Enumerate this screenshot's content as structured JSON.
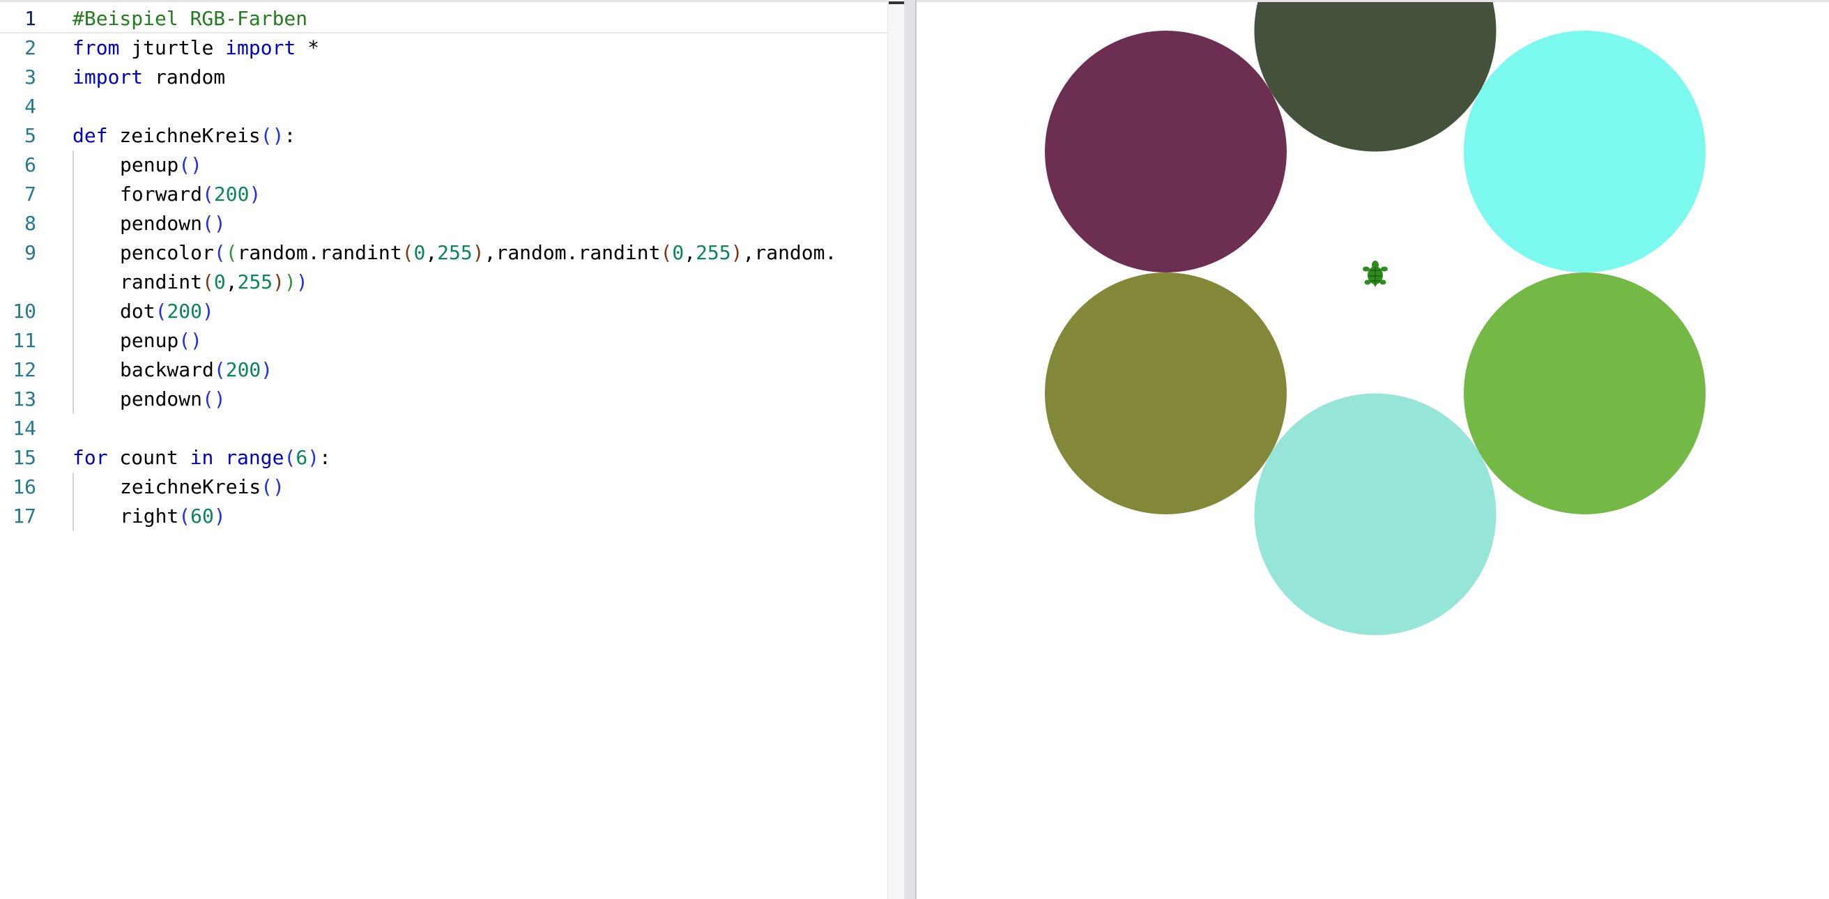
{
  "editor": {
    "lines": [
      {
        "num": "1",
        "indent": 0,
        "tokens": [
          {
            "t": "#Beispiel RGB-Farben",
            "c": "comment"
          }
        ]
      },
      {
        "num": "2",
        "indent": 0,
        "tokens": [
          {
            "t": "from",
            "c": "keyword"
          },
          {
            "t": " jturtle ",
            "c": "ident"
          },
          {
            "t": "import",
            "c": "keyword"
          },
          {
            "t": " *",
            "c": "op"
          }
        ]
      },
      {
        "num": "3",
        "indent": 0,
        "tokens": [
          {
            "t": "import",
            "c": "keyword"
          },
          {
            "t": " random",
            "c": "ident"
          }
        ]
      },
      {
        "num": "4",
        "indent": 0,
        "tokens": []
      },
      {
        "num": "5",
        "indent": 0,
        "tokens": [
          {
            "t": "def",
            "c": "keyword"
          },
          {
            "t": " zeichneKreis",
            "c": "ident"
          },
          {
            "t": "()",
            "c": "bracket1"
          },
          {
            "t": ":",
            "c": "op"
          }
        ]
      },
      {
        "num": "6",
        "indent": 1,
        "tokens": [
          {
            "t": "penup",
            "c": "ident"
          },
          {
            "t": "()",
            "c": "bracket1"
          }
        ]
      },
      {
        "num": "7",
        "indent": 1,
        "tokens": [
          {
            "t": "forward",
            "c": "ident"
          },
          {
            "t": "(",
            "c": "bracket1"
          },
          {
            "t": "200",
            "c": "number"
          },
          {
            "t": ")",
            "c": "bracket1"
          }
        ]
      },
      {
        "num": "8",
        "indent": 1,
        "tokens": [
          {
            "t": "pendown",
            "c": "ident"
          },
          {
            "t": "()",
            "c": "bracket1"
          }
        ]
      },
      {
        "num": "9",
        "indent": 1,
        "tokens": [
          {
            "t": "pencolor",
            "c": "ident"
          },
          {
            "t": "(",
            "c": "bracket1"
          },
          {
            "t": "(",
            "c": "bracket2"
          },
          {
            "t": "random.randint",
            "c": "ident"
          },
          {
            "t": "(",
            "c": "bracket3"
          },
          {
            "t": "0",
            "c": "number"
          },
          {
            "t": ",",
            "c": "op"
          },
          {
            "t": "255",
            "c": "number"
          },
          {
            "t": ")",
            "c": "bracket3"
          },
          {
            "t": ",random.randint",
            "c": "ident"
          },
          {
            "t": "(",
            "c": "bracket3"
          },
          {
            "t": "0",
            "c": "number"
          },
          {
            "t": ",",
            "c": "op"
          },
          {
            "t": "255",
            "c": "number"
          },
          {
            "t": ")",
            "c": "bracket3"
          },
          {
            "t": ",random.",
            "c": "ident"
          }
        ]
      },
      {
        "num": "",
        "indent": 1,
        "tokens": [
          {
            "t": "randint",
            "c": "ident"
          },
          {
            "t": "(",
            "c": "bracket3"
          },
          {
            "t": "0",
            "c": "number"
          },
          {
            "t": ",",
            "c": "op"
          },
          {
            "t": "255",
            "c": "number"
          },
          {
            "t": ")",
            "c": "bracket3"
          },
          {
            "t": ")",
            "c": "bracket2"
          },
          {
            "t": ")",
            "c": "bracket1"
          }
        ]
      },
      {
        "num": "10",
        "indent": 1,
        "tokens": [
          {
            "t": "dot",
            "c": "ident"
          },
          {
            "t": "(",
            "c": "bracket1"
          },
          {
            "t": "200",
            "c": "number"
          },
          {
            "t": ")",
            "c": "bracket1"
          }
        ]
      },
      {
        "num": "11",
        "indent": 1,
        "tokens": [
          {
            "t": "penup",
            "c": "ident"
          },
          {
            "t": "()",
            "c": "bracket1"
          }
        ]
      },
      {
        "num": "12",
        "indent": 1,
        "tokens": [
          {
            "t": "backward",
            "c": "ident"
          },
          {
            "t": "(",
            "c": "bracket1"
          },
          {
            "t": "200",
            "c": "number"
          },
          {
            "t": ")",
            "c": "bracket1"
          }
        ]
      },
      {
        "num": "13",
        "indent": 1,
        "tokens": [
          {
            "t": "pendown",
            "c": "ident"
          },
          {
            "t": "()",
            "c": "bracket1"
          }
        ]
      },
      {
        "num": "14",
        "indent": 0,
        "tokens": []
      },
      {
        "num": "15",
        "indent": 0,
        "tokens": [
          {
            "t": "for",
            "c": "keyword"
          },
          {
            "t": " count ",
            "c": "ident"
          },
          {
            "t": "in",
            "c": "keyword"
          },
          {
            "t": " ",
            "c": "ident"
          },
          {
            "t": "range",
            "c": "builtin"
          },
          {
            "t": "(",
            "c": "bracket1"
          },
          {
            "t": "6",
            "c": "number"
          },
          {
            "t": ")",
            "c": "bracket1"
          },
          {
            "t": ":",
            "c": "op"
          }
        ]
      },
      {
        "num": "16",
        "indent": 1,
        "tokens": [
          {
            "t": "zeichneKreis",
            "c": "ident"
          },
          {
            "t": "()",
            "c": "bracket1"
          }
        ]
      },
      {
        "num": "17",
        "indent": 1,
        "tokens": [
          {
            "t": "right",
            "c": "ident"
          },
          {
            "t": "(",
            "c": "bracket1"
          },
          {
            "t": "60",
            "c": "number"
          },
          {
            "t": ")",
            "c": "bracket1"
          }
        ]
      }
    ]
  },
  "turtle_canvas": {
    "dots": [
      {
        "color": "#44523c",
        "heading_deg": 0
      },
      {
        "color": "#7bf9ef",
        "heading_deg": 60
      },
      {
        "color": "#74b846",
        "heading_deg": 120
      },
      {
        "color": "#96e6d8",
        "heading_deg": 180
      },
      {
        "color": "#838838",
        "heading_deg": 240
      },
      {
        "color": "#6c2f52",
        "heading_deg": 300
      }
    ],
    "move_distance": 200,
    "dot_size": 200,
    "turtle_icon": "turtle-icon",
    "turtle_color": "#2e8b1e"
  }
}
